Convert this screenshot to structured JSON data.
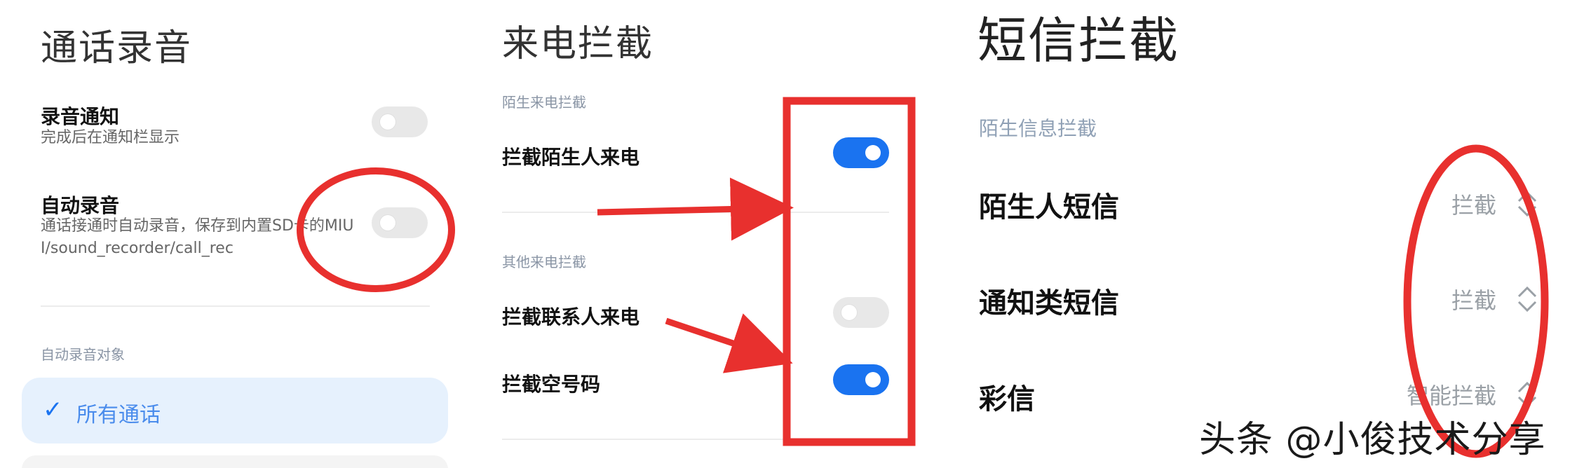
{
  "panel1": {
    "title": "通话录音",
    "notify_title": "录音通知",
    "notify_sub": "完成后在通知栏显示",
    "auto_title": "自动录音",
    "auto_sub": "通话接通时自动录音，保存到内置SD卡的MIUI/sound_recorder/call_rec",
    "section": "自动录音对象",
    "selected_option": "所有通话",
    "check_glyph": "✓",
    "notify_toggle": "off",
    "auto_toggle": "off"
  },
  "panel2": {
    "title": "来电拦截",
    "section1": "陌生来电拦截",
    "row1": "拦截陌生人来电",
    "section2": "其他来电拦截",
    "row2": "拦截联系人来电",
    "row3": "拦截空号码",
    "row1_toggle": "on",
    "row2_toggle": "off",
    "row3_toggle": "on"
  },
  "panel3": {
    "title": "短信拦截",
    "section": "陌生信息拦截",
    "row1": "陌生人短信",
    "row1_value": "拦截",
    "row2": "通知类短信",
    "row2_value": "拦截",
    "row3": "彩信",
    "row3_value": "智能拦截"
  },
  "watermark": "头条 @小俊技术分享",
  "colors": {
    "accent": "#1a73f0",
    "annotation_red": "#e8302e",
    "selected_bg": "#e6f1fd",
    "toggle_off": "#e8e8e8"
  },
  "icons": [
    "checkmark-icon",
    "chevron-updown-icon"
  ]
}
